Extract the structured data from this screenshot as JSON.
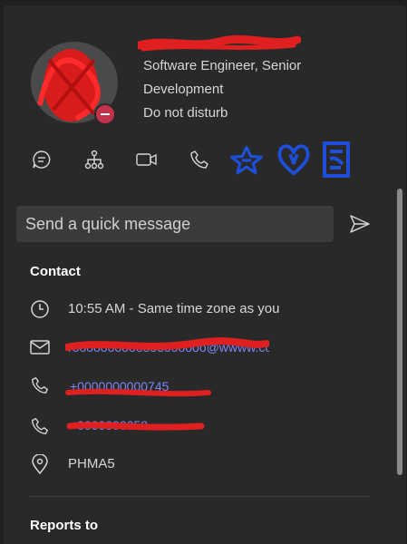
{
  "profile": {
    "name": "[redacted]",
    "title": "Software Engineer, Senior",
    "department": "Development",
    "status": "Do not disturb",
    "status_color": "#c4314b"
  },
  "actions": [
    {
      "icon": "chat-icon"
    },
    {
      "icon": "org-chart-icon"
    },
    {
      "icon": "video-call-icon"
    },
    {
      "icon": "phone-call-icon"
    }
  ],
  "quick_message": {
    "placeholder": "Send a quick message",
    "send_icon": "send-icon"
  },
  "contact": {
    "heading": "Contact",
    "local_time": "10:55 AM - Same time zone as you",
    "email": "[redacted]",
    "phone_work": "[redacted]",
    "phone_mobile": "[redacted]",
    "location": "PHMA5"
  },
  "reports_to": {
    "heading": "Reports to"
  },
  "colors": {
    "background": "#292929",
    "link": "#7f85f5",
    "annotation_red": "#e02020",
    "annotation_blue": "#1e4fd8"
  }
}
